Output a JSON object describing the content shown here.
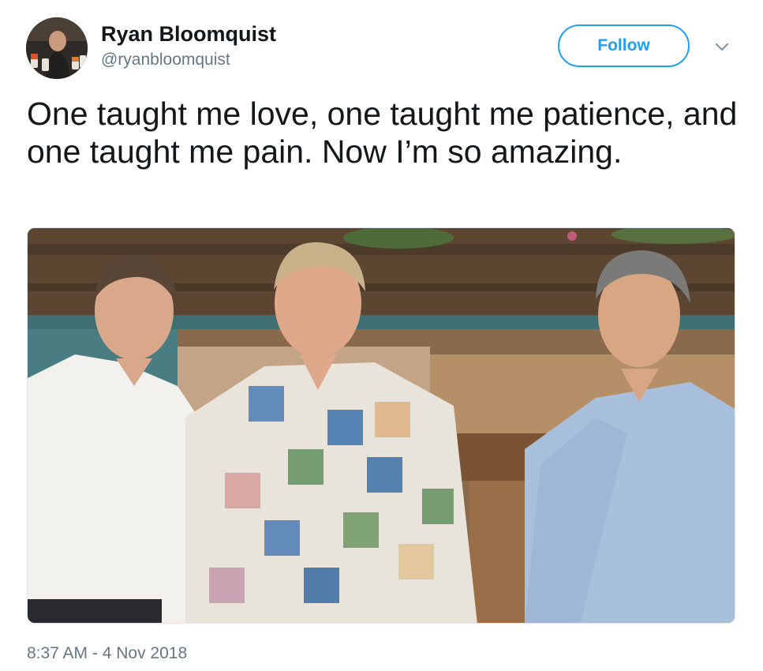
{
  "author": {
    "display_name": "Ryan Bloomquist",
    "handle": "@ryanbloomquist"
  },
  "follow_button": {
    "label": "Follow"
  },
  "menu": {
    "icon": "chevron-down-icon"
  },
  "tweet": {
    "text": "One taught me love, one taught me patience, and one taught me pain. Now I’m so amazing.",
    "timestamp": "8:37 AM - 4 Nov 2018"
  },
  "colors": {
    "accent": "#1da1f2",
    "text": "#14171a",
    "secondary_text": "#657786"
  }
}
